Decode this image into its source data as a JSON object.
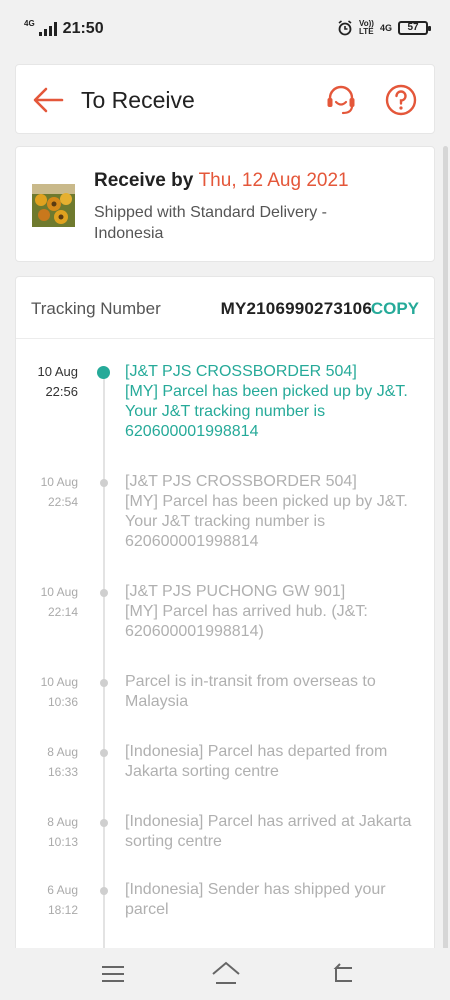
{
  "status_bar": {
    "net_small": "4G",
    "time": "21:50",
    "volte": "Vo))\nLTE",
    "network": "4G",
    "battery": "57"
  },
  "header": {
    "title": "To Receive",
    "accent_color": "#e4573a"
  },
  "receive": {
    "prefix": "Receive by",
    "date": "Thu, 12 Aug 2021",
    "shipping": "Shipped with Standard Delivery - Indonesia"
  },
  "tracking": {
    "label": "Tracking Number",
    "number": "MY2106990273106",
    "copy_label": "COPY",
    "events": [
      {
        "date": "10 Aug",
        "time": "22:56",
        "text": "[J&T PJS CROSSBORDER 504]\n[MY] Parcel has been picked up by J&T. Your J&T tracking number is 620600001998814",
        "active": true
      },
      {
        "date": "10 Aug",
        "time": "22:54",
        "text": "[J&T PJS CROSSBORDER 504]\n[MY] Parcel has been picked up by J&T. Your J&T tracking number is 620600001998814",
        "active": false
      },
      {
        "date": "10 Aug",
        "time": "22:14",
        "text": "[J&T PJS PUCHONG GW 901]\n[MY] Parcel has arrived hub. (J&T: 620600001998814)",
        "active": false
      },
      {
        "date": "10 Aug",
        "time": "10:36",
        "text": "Parcel is in-transit from overseas to Malaysia",
        "active": false
      },
      {
        "date": "8 Aug",
        "time": "16:33",
        "text": "[Indonesia] Parcel has departed from Jakarta sorting centre",
        "active": false
      },
      {
        "date": "8 Aug",
        "time": "10:13",
        "text": "[Indonesia] Parcel has arrived at Jakarta sorting centre",
        "active": false
      },
      {
        "date": "6 Aug",
        "time": "18:12",
        "text": "[Indonesia] Sender has shipped your parcel",
        "active": false
      }
    ]
  }
}
